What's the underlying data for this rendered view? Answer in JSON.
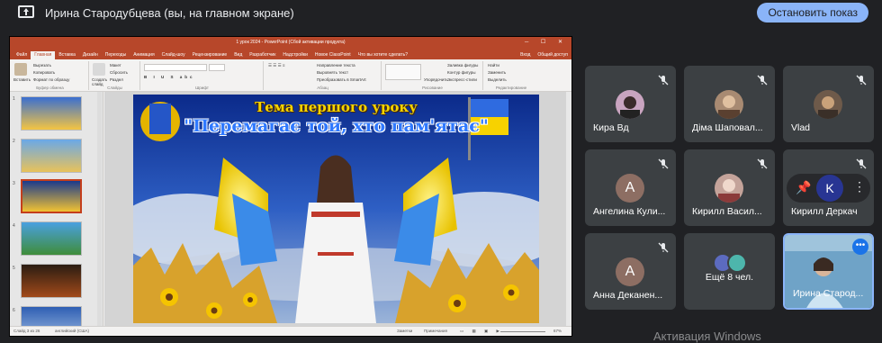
{
  "topbar": {
    "presenter_title": "Ирина Стародубцева (вы, на главном экране)",
    "stop_button": "Остановить показ"
  },
  "ppt": {
    "window_title": "1 урок 2024 - PowerPoint (Сбой активации продукта)",
    "tabs": [
      "Файл",
      "Главная",
      "Вставка",
      "Дизайн",
      "Переходы",
      "Анимация",
      "Слайд-шоу",
      "Рецензирование",
      "Вид",
      "Разработчик",
      "Надстройки",
      "Новое ClassPoint",
      "Что вы хотите сделать?"
    ],
    "right_tabs": [
      "Вход",
      "Общий доступ"
    ],
    "ribbon": {
      "paste": "Вставить",
      "cut": "Вырезать",
      "copy": "Копировать",
      "format_painter": "Формат по образцу",
      "clipboard": "Буфер обмена",
      "new_slide": "Создать слайд",
      "layout": "Макет",
      "reset": "Сбросить",
      "section": "Раздел",
      "slides": "Слайды",
      "font": "Шрифт",
      "text_direction": "Направление текста",
      "align_text": "Выровнять текст",
      "smartart": "Преобразовать в SmartArt",
      "paragraph": "Абзац",
      "arrange": "Упорядочить",
      "quick_styles": "Экспресс-стили",
      "drawing": "Рисование",
      "shape_fill": "Заливка фигуры",
      "shape_outline": "Контур фигуры",
      "shape_effects": "Эффекты фигуры",
      "find": "Найти",
      "replace": "Заменить",
      "select": "Выделить",
      "editing": "Редактирование"
    },
    "slide_numbers": [
      "1",
      "2",
      "3",
      "4",
      "5",
      "6"
    ],
    "status": {
      "slide_count": "Слайд 3 из 26",
      "language": "английский (США)",
      "notes": "Заметки",
      "comments": "Примечания",
      "zoom": "67%"
    },
    "slide": {
      "title": "Тема першого уроку",
      "subtitle": "\"Перемагає той, хто пам'ятає\""
    }
  },
  "participants": [
    {
      "name": "Кира Вд",
      "avatar": "photo",
      "color": "#c9a4c0"
    },
    {
      "name": "Діма Шаповал...",
      "avatar": "photo",
      "color": "#a88a72"
    },
    {
      "name": "Vlad",
      "avatar": "photo",
      "color": "#6e5a4a"
    },
    {
      "name": "Ангелина Кули...",
      "avatar": "A",
      "color": "#8d6e63"
    },
    {
      "name": "Кирилл Васил...",
      "avatar": "photo",
      "color": "#c4a39a"
    },
    {
      "name": "Кирилл Деркач",
      "avatar": "K",
      "color": "#283593"
    },
    {
      "name": "Анна Деканен...",
      "avatar": "A",
      "color": "#8d6e63"
    },
    {
      "name": "Ещё 8 чел.",
      "avatar": "group",
      "color": "#5c6bc0"
    },
    {
      "name": "Ирина Старод...",
      "avatar": "self",
      "color": "#6fa3c7"
    }
  ],
  "watermark": "Активация Windows",
  "colors": {
    "accent": "#8ab4f8",
    "tile_bg": "#3c4043",
    "ppt_red": "#b7472a"
  }
}
